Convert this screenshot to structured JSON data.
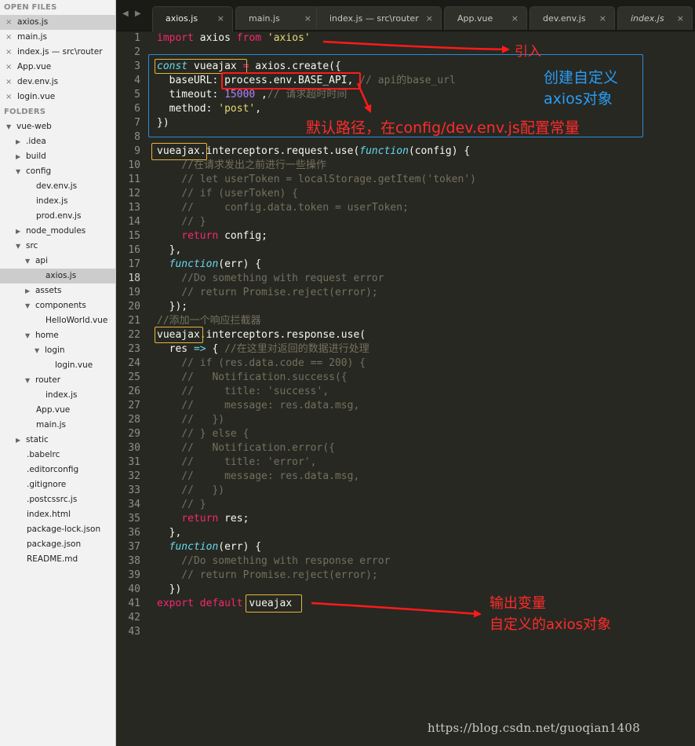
{
  "sidebar": {
    "open_files_header": "OPEN FILES",
    "open_files": [
      "axios.js",
      "main.js",
      "index.js — src\\router",
      "App.vue",
      "dev.env.js",
      "login.vue"
    ],
    "folders_header": "FOLDERS",
    "tree": [
      {
        "label": "vue-web",
        "type": "folder-open"
      },
      {
        "label": ".idea",
        "type": "folder-closed"
      },
      {
        "label": "build",
        "type": "folder-closed"
      },
      {
        "label": "config",
        "type": "folder-open"
      },
      {
        "label": "dev.env.js",
        "type": "file"
      },
      {
        "label": "index.js",
        "type": "file"
      },
      {
        "label": "prod.env.js",
        "type": "file"
      },
      {
        "label": "node_modules",
        "type": "folder-closed"
      },
      {
        "label": "src",
        "type": "folder-open"
      },
      {
        "label": "api",
        "type": "folder-open"
      },
      {
        "label": "axios.js",
        "type": "file"
      },
      {
        "label": "assets",
        "type": "folder-closed"
      },
      {
        "label": "components",
        "type": "folder-open"
      },
      {
        "label": "HelloWorld.vue",
        "type": "file"
      },
      {
        "label": "home",
        "type": "folder-open"
      },
      {
        "label": "login",
        "type": "folder-open"
      },
      {
        "label": "login.vue",
        "type": "file"
      },
      {
        "label": "router",
        "type": "folder-open"
      },
      {
        "label": "index.js",
        "type": "file"
      },
      {
        "label": "App.vue",
        "type": "file"
      },
      {
        "label": "main.js",
        "type": "file"
      },
      {
        "label": "static",
        "type": "folder-closed"
      },
      {
        "label": ".babelrc",
        "type": "file"
      },
      {
        "label": ".editorconfig",
        "type": "file"
      },
      {
        "label": ".gitignore",
        "type": "file"
      },
      {
        "label": ".postcssrc.js",
        "type": "file"
      },
      {
        "label": "index.html",
        "type": "file"
      },
      {
        "label": "package-lock.json",
        "type": "file"
      },
      {
        "label": "package.json",
        "type": "file"
      },
      {
        "label": "README.md",
        "type": "file"
      }
    ]
  },
  "tabs": [
    {
      "label": "axios.js",
      "active": true,
      "italic": false
    },
    {
      "label": "main.js",
      "active": false,
      "italic": false
    },
    {
      "label": "index.js — src\\router",
      "active": false,
      "italic": false
    },
    {
      "label": "App.vue",
      "active": false,
      "italic": false
    },
    {
      "label": "dev.env.js",
      "active": false,
      "italic": false
    },
    {
      "label": "index.js",
      "active": false,
      "italic": true
    }
  ],
  "tab_close_glyph": "×",
  "nav_glyphs": [
    "◀",
    "▶"
  ],
  "editor": {
    "current_line": 18,
    "lines": [
      [
        [
          "kw",
          "import"
        ],
        [
          "tx",
          " axios "
        ],
        [
          "kw",
          "from"
        ],
        [
          "tx",
          " "
        ],
        [
          "str",
          "'axios'"
        ]
      ],
      [],
      [
        [
          "fn",
          "const"
        ],
        [
          "tx",
          " vueajax "
        ],
        [
          "kw",
          "="
        ],
        [
          "tx",
          " axios.create({"
        ]
      ],
      [
        [
          "tx",
          "  baseURL: process.env.BASE_API, "
        ],
        [
          "cm",
          "// api的base_url"
        ]
      ],
      [
        [
          "tx",
          "  timeout: "
        ],
        [
          "num",
          "15000"
        ],
        [
          "tx",
          " ,"
        ],
        [
          "cm",
          "// 请求超时时间"
        ]
      ],
      [
        [
          "tx",
          "  method: "
        ],
        [
          "str",
          "'post'"
        ],
        [
          "tx",
          ","
        ]
      ],
      [
        [
          "tx",
          "})"
        ]
      ],
      [],
      [
        [
          "tx",
          "vueajax.interceptors.request.use("
        ],
        [
          "fn",
          "function"
        ],
        [
          "tx",
          "(config) {"
        ]
      ],
      [
        [
          "cm",
          "    //在请求发出之前进行一些操作"
        ]
      ],
      [
        [
          "cm",
          "    // let userToken = localStorage.getItem('token')"
        ]
      ],
      [
        [
          "cm",
          "    // if (userToken) {"
        ]
      ],
      [
        [
          "cm",
          "    //     config.data.token = userToken;"
        ]
      ],
      [
        [
          "cm",
          "    // }"
        ]
      ],
      [
        [
          "tx",
          "    "
        ],
        [
          "kw",
          "return"
        ],
        [
          "tx",
          " config;"
        ]
      ],
      [
        [
          "tx",
          "  },"
        ]
      ],
      [
        [
          "tx",
          "  "
        ],
        [
          "fn",
          "function"
        ],
        [
          "tx",
          "(err) {"
        ]
      ],
      [
        [
          "cm",
          "    //Do something with request error"
        ]
      ],
      [
        [
          "cm",
          "    // return Promise.reject(error);"
        ]
      ],
      [
        [
          "tx",
          "  });"
        ]
      ],
      [
        [
          "cm",
          "//添加一个响应拦截器"
        ]
      ],
      [
        [
          "tx",
          "vueajax.interceptors.response.use("
        ]
      ],
      [
        [
          "tx",
          "  res "
        ],
        [
          "fn",
          "=>"
        ],
        [
          "tx",
          " { "
        ],
        [
          "cm",
          "//在这里对返回的数据进行处理"
        ]
      ],
      [
        [
          "cm",
          "    // if (res.data.code == 200) {"
        ]
      ],
      [
        [
          "cm",
          "    //   Notification.success({"
        ]
      ],
      [
        [
          "cm",
          "    //     title: 'success',"
        ]
      ],
      [
        [
          "cm",
          "    //     message: res.data.msg,"
        ]
      ],
      [
        [
          "cm",
          "    //   })"
        ]
      ],
      [
        [
          "cm",
          "    // } else {"
        ]
      ],
      [
        [
          "cm",
          "    //   Notification.error({"
        ]
      ],
      [
        [
          "cm",
          "    //     title: 'error',"
        ]
      ],
      [
        [
          "cm",
          "    //     message: res.data.msg,"
        ]
      ],
      [
        [
          "cm",
          "    //   })"
        ]
      ],
      [
        [
          "cm",
          "    // }"
        ]
      ],
      [
        [
          "tx",
          "    "
        ],
        [
          "kw",
          "return"
        ],
        [
          "tx",
          " res;"
        ]
      ],
      [
        [
          "tx",
          "  },"
        ]
      ],
      [
        [
          "tx",
          "  "
        ],
        [
          "fn",
          "function"
        ],
        [
          "tx",
          "(err) {"
        ]
      ],
      [
        [
          "cm",
          "    //Do something with response error"
        ]
      ],
      [
        [
          "cm",
          "    // return Promise.reject(error);"
        ]
      ],
      [
        [
          "tx",
          "  })"
        ]
      ],
      [
        [
          "kw",
          "export"
        ],
        [
          "tx",
          " "
        ],
        [
          "kw",
          "default"
        ],
        [
          "tx",
          " vueajax"
        ]
      ],
      [],
      []
    ]
  },
  "annotations": {
    "import_note": "引入",
    "create_note_line1": "创建自定义",
    "create_note_line2": "axios对象",
    "baseurl_note": "默认路径，在config/dev.env.js配置常量",
    "export_note_line1": "输出变量",
    "export_note_line2": "自定义的axios对象",
    "red_color": "#ff2b2b",
    "blue_color": "#2a9df4",
    "yellow_color": "#e6b53c"
  },
  "watermark": "https://blog.csdn.net/guoqian1408"
}
